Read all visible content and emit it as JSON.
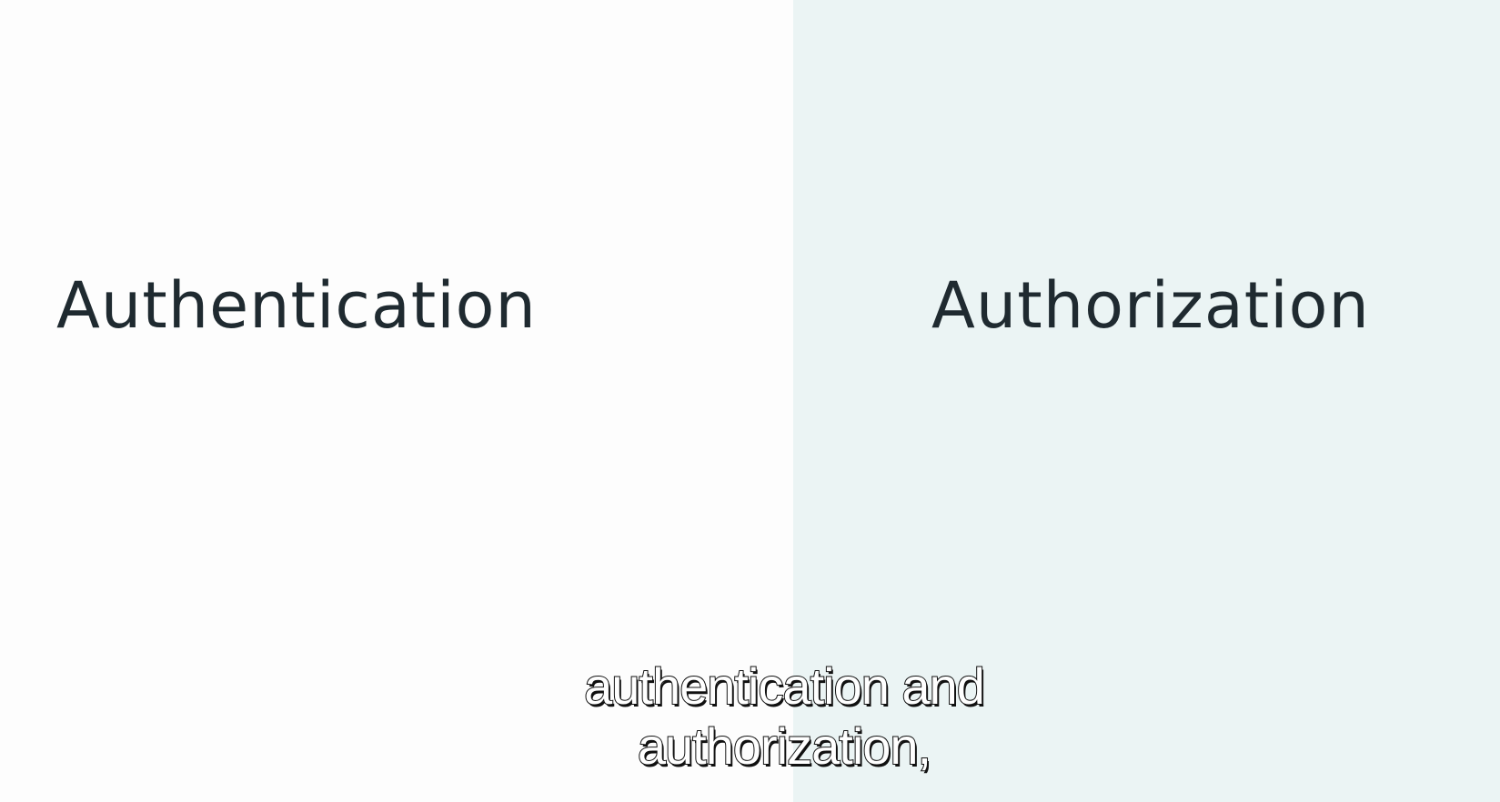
{
  "slide": {
    "left_heading": "Authentication",
    "right_heading": "Authorization",
    "colors": {
      "left_background": "#fdfdfd",
      "right_background": "#ebf4f4",
      "heading_text": "#1f2a30"
    }
  },
  "subtitle": {
    "line1": "authentication and",
    "line2": "authorization,"
  }
}
